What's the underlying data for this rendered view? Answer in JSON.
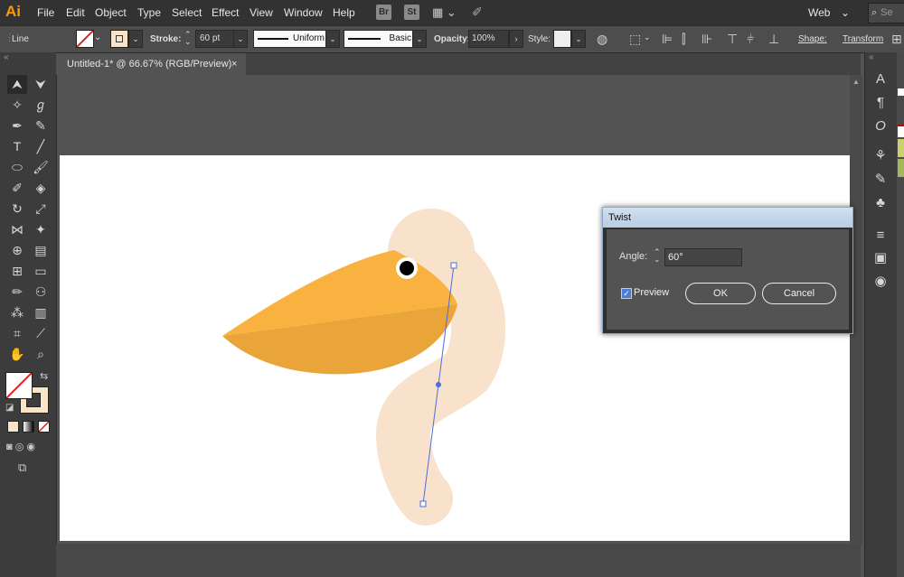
{
  "app": {
    "logo": "Ai",
    "menus": [
      "File",
      "Edit",
      "Object",
      "Type",
      "Select",
      "Effect",
      "View",
      "Window",
      "Help"
    ],
    "bridge": "Br",
    "stock": "St",
    "workspace": "Web",
    "search_placeholder": "Se"
  },
  "control": {
    "selection": "Line",
    "stroke_label": "Stroke:",
    "stroke_value": "60 pt",
    "profile": "Uniform",
    "brush": "Basic",
    "opacity_label": "Opacity:",
    "opacity_value": "100%",
    "style_label": "Style:",
    "shape_label": "Shape:",
    "transform_label": "Transform"
  },
  "document": {
    "tab_title": "Untitled-1* @ 66.67% (RGB/Preview)",
    "close": "×"
  },
  "dialog": {
    "title": "Twist",
    "angle_label": "Angle:",
    "angle_value": "60°",
    "preview_label": "Preview",
    "preview_checked": true,
    "ok_label": "OK",
    "cancel_label": "Cancel"
  },
  "colors": {
    "beak_light": "#f9b13f",
    "beak_dark": "#e9a53a",
    "body": "#f8e2cb",
    "eye": "#000000",
    "path": "#4a6ee6",
    "selected_fill": "#f9e4c8"
  }
}
